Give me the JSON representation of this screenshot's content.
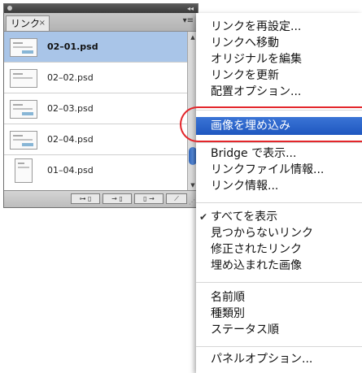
{
  "panel": {
    "tab_label": "リンク",
    "tab_close": "×",
    "menu_icon": "▾≡",
    "collapse_icon": "◂◂",
    "files": [
      {
        "name": "02–01.psd",
        "selected": true
      },
      {
        "name": "02–02.psd",
        "selected": false
      },
      {
        "name": "02–03.psd",
        "selected": false
      },
      {
        "name": "02–04.psd",
        "selected": false
      },
      {
        "name": "01–04.psd",
        "selected": false
      }
    ],
    "toolbar": {
      "relink_icon": "relink-icon",
      "goto_link_icon": "goto-link-icon",
      "update_link_icon": "update-link-icon",
      "edit_original_icon": "edit-original-icon"
    }
  },
  "menu": {
    "items": [
      {
        "label": "リンクを再設定..."
      },
      {
        "label": "リンクへ移動"
      },
      {
        "label": "オリジナルを編集"
      },
      {
        "label": "リンクを更新"
      },
      {
        "label": "配置オプション..."
      },
      {
        "label": "画像を埋め込み",
        "highlighted": true
      },
      {
        "label": "Bridge で表示..."
      },
      {
        "label": "リンクファイル情報..."
      },
      {
        "label": "リンク情報..."
      },
      {
        "label": "すべてを表示",
        "checked": true
      },
      {
        "label": "見つからないリンク"
      },
      {
        "label": "修正されたリンク"
      },
      {
        "label": "埋め込まれた画像"
      },
      {
        "label": "名前順"
      },
      {
        "label": "種類別"
      },
      {
        "label": "ステータス順"
      },
      {
        "label": "パネルオプション..."
      }
    ],
    "check_mark": "✔"
  },
  "colors": {
    "selection": "#a9c5e8",
    "menu_highlight": "#2a64cc",
    "callout_ring": "#e3262b"
  }
}
